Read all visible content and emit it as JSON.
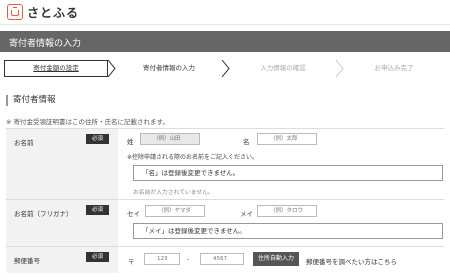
{
  "header": {
    "logo_text": "さとふる"
  },
  "title_bar": {
    "title": "寄付者情報の入力"
  },
  "steps": [
    {
      "label": "寄付金額の設定"
    },
    {
      "label": "寄付者情報の入力"
    },
    {
      "label": "入力情報の確認"
    },
    {
      "label": "お申込み完了"
    }
  ],
  "section": {
    "title": "寄付者情報",
    "note": "※ 寄付金受領証明書はこの住所・氏名に記載されます。"
  },
  "required_label": "必須",
  "name_row": {
    "label": "お名前",
    "last_label": "姓",
    "last_placeholder": "（例）山田",
    "first_label": "名",
    "first_placeholder": "（例）太郎",
    "hint": "※控除申請される際のお名前をご記入ください。",
    "notice": "「名」は登録後変更できません。",
    "error": "お名前が入力されていません。"
  },
  "kana_row": {
    "label": "お名前（フリガナ）",
    "last_label": "セイ",
    "last_placeholder": "（例）ヤマダ",
    "first_label": "メイ",
    "first_placeholder": "（例）タロウ",
    "notice": "「メイ」は登録後変更できません。"
  },
  "zip_row": {
    "label": "郵便番号",
    "prefix": "〒",
    "part1_placeholder": "123",
    "separator": "-",
    "part2_placeholder": "4567",
    "autofill_button": "住所自動入力",
    "lookup_text": "郵便番号を調べたい方はこちら"
  }
}
